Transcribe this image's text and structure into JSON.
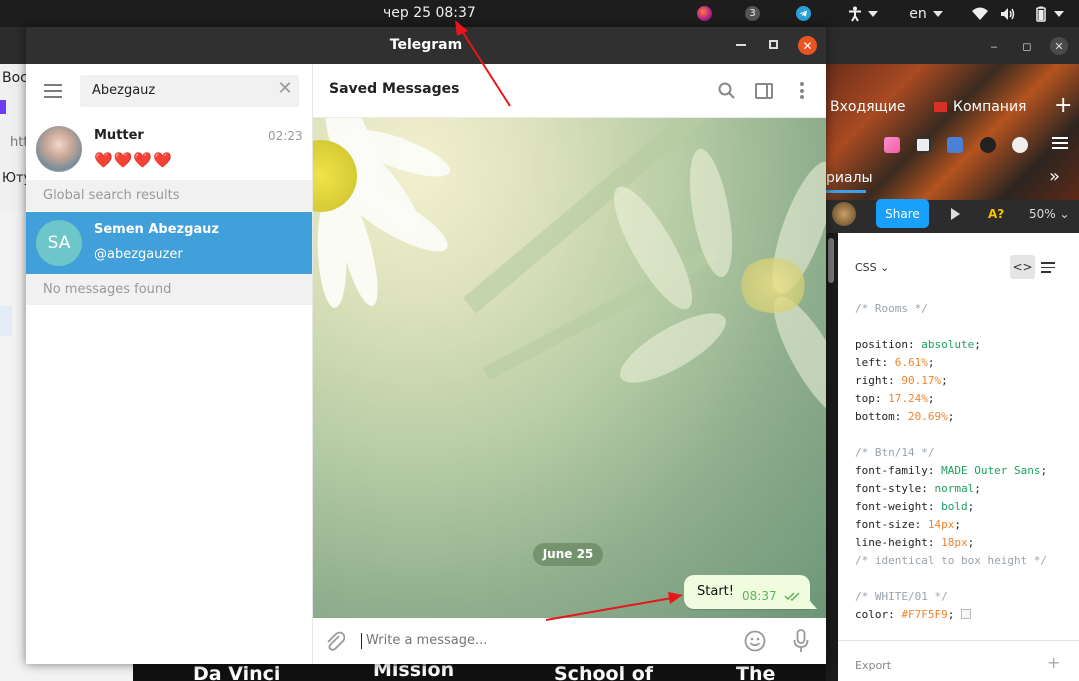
{
  "topbar": {
    "clock": "чер 25  08:37",
    "notification_count": "3",
    "language": "en"
  },
  "background_browser": {
    "left_labels": [
      "Вос",
      "htt",
      "Ютуб"
    ],
    "tabs": [
      {
        "label": "Входящие"
      },
      {
        "label": "Компания"
      }
    ],
    "series_label": "риалы",
    "figma": {
      "share_label": "Share",
      "a_label": "A?",
      "zoom": "50%",
      "css_label": "CSS",
      "code_icon": "<>",
      "export_label": "Export",
      "code": {
        "c1": "/* Rooms */",
        "l1p": "position",
        "l1v": "absolute",
        "l2p": "left",
        "l2v": "6.61%",
        "l3p": "right",
        "l3v": "90.17%",
        "l4p": "top",
        "l4v": "17.24%",
        "l5p": "bottom",
        "l5v": "20.69%",
        "c2": "/* Btn/14 */",
        "l6p": "font-family",
        "l6v": "MADE Outer Sans",
        "l7p": "font-style",
        "l7v": "normal",
        "l8p": "font-weight",
        "l8v": "bold",
        "l9p": "font-size",
        "l9v": "14px",
        "l10p": "line-height",
        "l10v": "18px",
        "c3": "/* identical to box height */",
        "c4": "/* WHITE/01 */",
        "l11p": "color",
        "l11v": "#F7F5F9"
      }
    },
    "bottom_titles": [
      "Da Vinci",
      "Mission",
      "School of",
      "The"
    ]
  },
  "telegram": {
    "window_title": "Telegram",
    "search": {
      "value": "Abezgauz"
    },
    "chats": [
      {
        "name": "Mutter",
        "time": "02:23",
        "preview": "❤️❤️❤️❤️"
      }
    ],
    "global_section": "Global search results",
    "global_results": [
      {
        "initials": "SA",
        "name": "Semen Abezgauz",
        "username": "@abezgauzer"
      }
    ],
    "no_messages": "No messages found",
    "peer_name": "Saved Messages",
    "date_pill": "June 25",
    "message": {
      "text": "Start!",
      "time": "08:37"
    },
    "input_placeholder": "Write a message..."
  },
  "colors": {
    "accent": "#419fd9",
    "close": "#e95420",
    "bubble": "#effdde",
    "annotation": "#e8161b"
  }
}
